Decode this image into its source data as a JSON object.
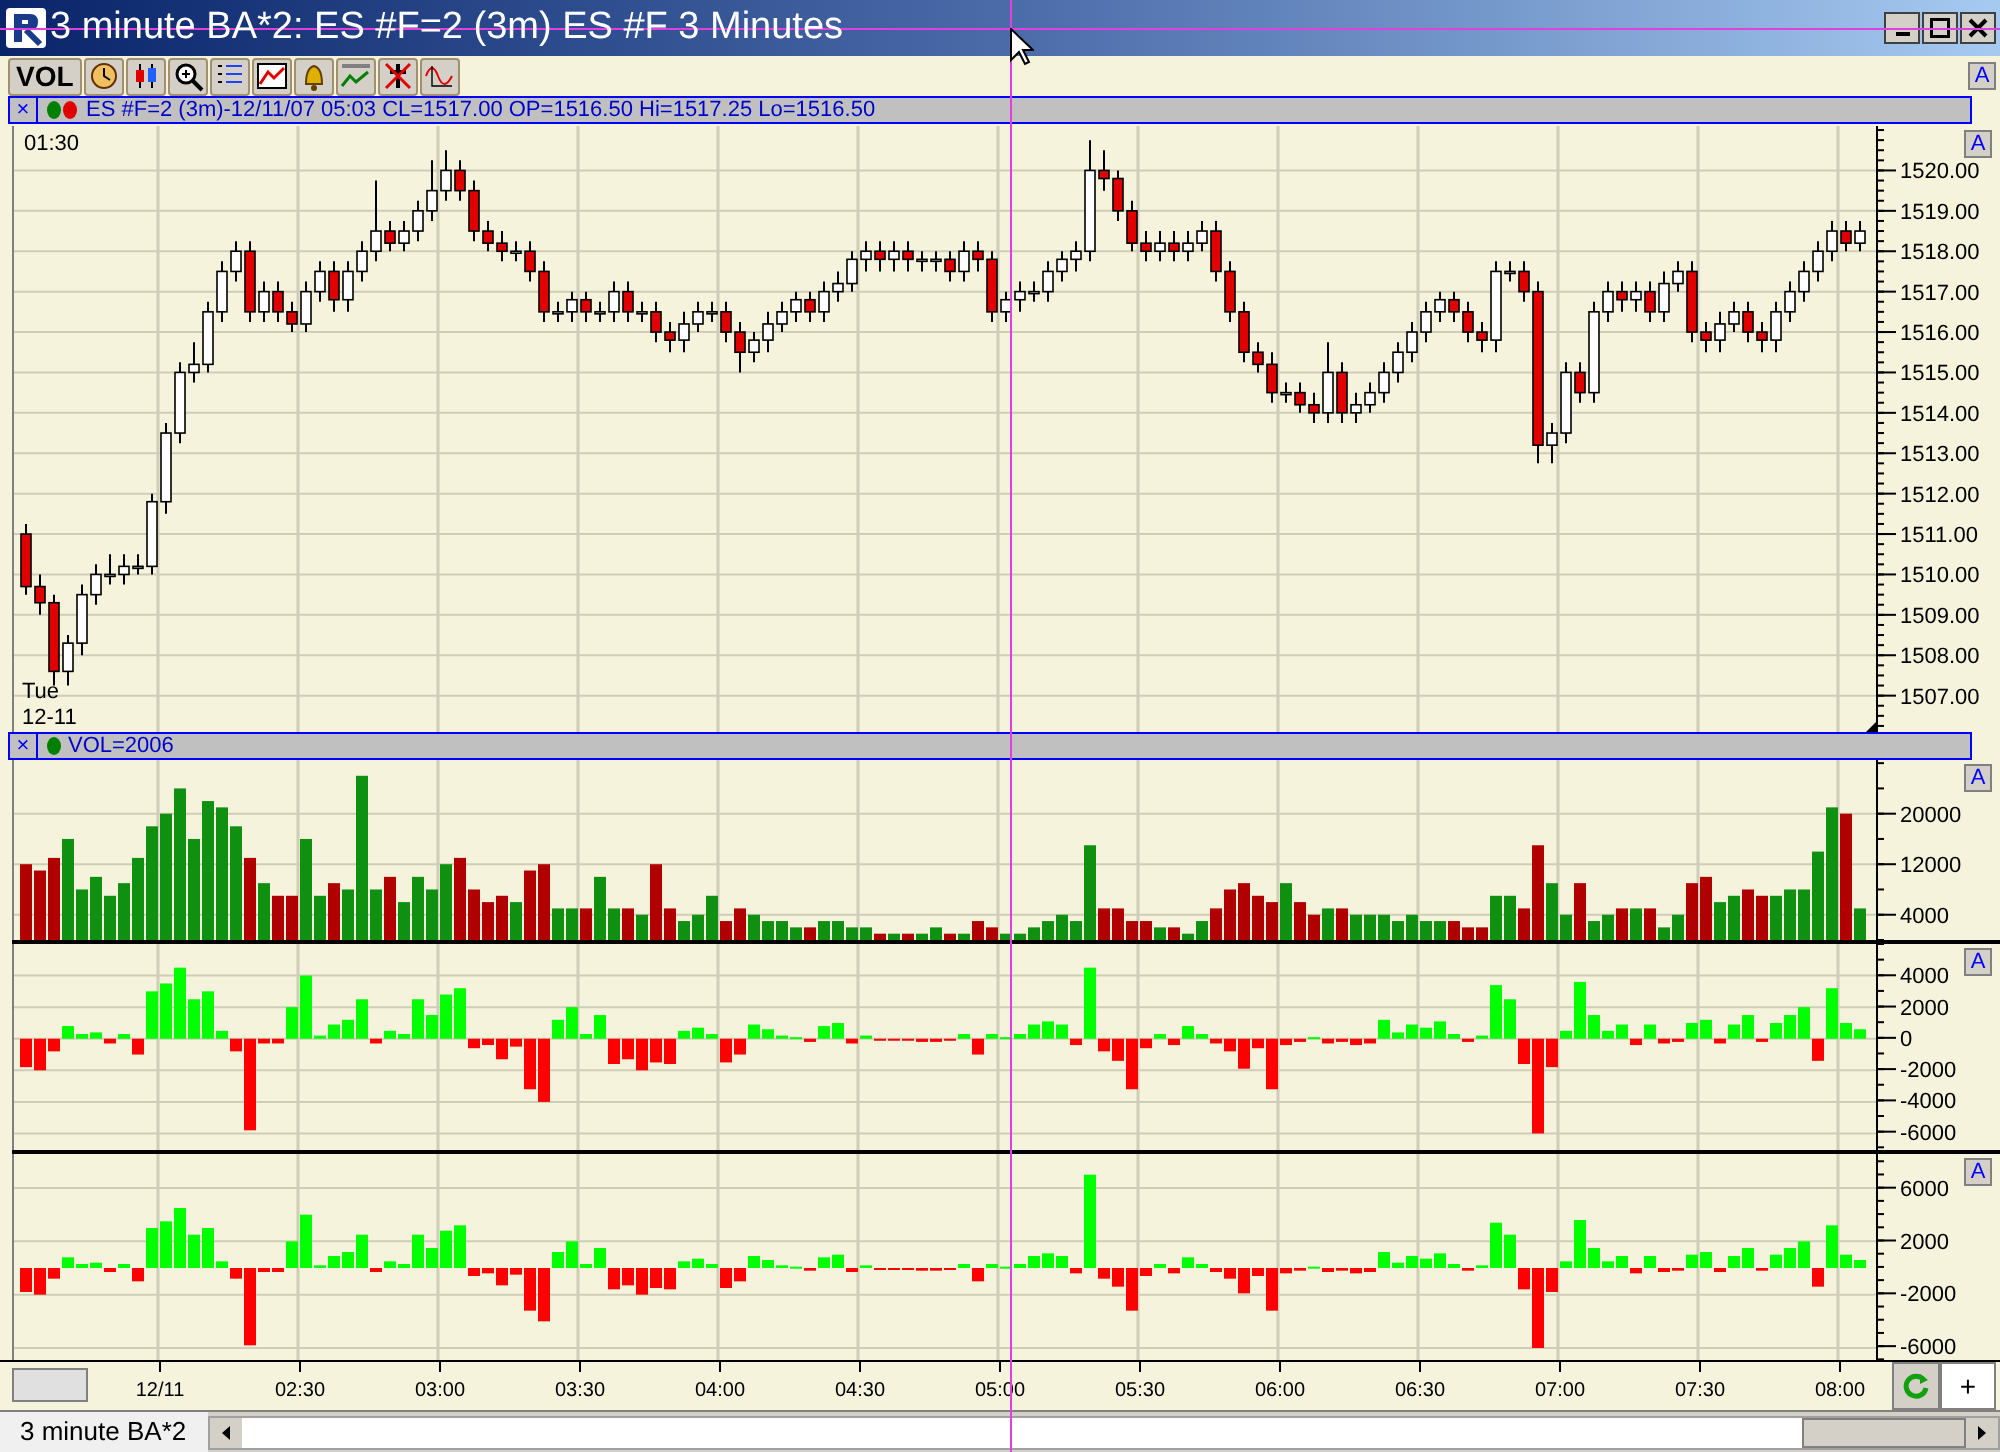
{
  "window": {
    "title": "3 minute BA*2: ES #F=2 (3m) ES #F 3 Minutes"
  },
  "toolbar": {
    "label": "VOL",
    "autoscale_label": "A"
  },
  "price_pane": {
    "close_label": "×",
    "legend": "ES #F=2 (3m)-12/11/07 05:03 CL=1517.00 OP=1516.50 Hi=1517.25 Lo=1516.50",
    "time_label": "01:30",
    "day_label": "Tue",
    "date_label": "12-11",
    "autoscale_label": "A",
    "chart_data": {
      "type": "candlestick",
      "grid": true,
      "ylim": [
        1506.1,
        1521.1
      ],
      "yticks": [
        {
          "value": 1507,
          "label": "1507.00"
        },
        {
          "value": 1508,
          "label": "1508.00"
        },
        {
          "value": 1509,
          "label": "1509.00"
        },
        {
          "value": 1510,
          "label": "1510.00"
        },
        {
          "value": 1511,
          "label": "1511.00"
        },
        {
          "value": 1512,
          "label": "1512.00"
        },
        {
          "value": 1513,
          "label": "1513.00"
        },
        {
          "value": 1514,
          "label": "1514.00"
        },
        {
          "value": 1515,
          "label": "1515.00"
        },
        {
          "value": 1516,
          "label": "1516.00"
        },
        {
          "value": 1517,
          "label": "1517.00"
        },
        {
          "value": 1518,
          "label": "1518.00"
        },
        {
          "value": 1519,
          "label": "1519.00"
        },
        {
          "value": 1520,
          "label": "1520.00"
        }
      ],
      "ohlc": [
        [
          1511,
          1511.25,
          1509.5,
          1509.7
        ],
        [
          1509.7,
          1510,
          1509,
          1509.3
        ],
        [
          1509.3,
          1509.5,
          1507.25,
          1507.6
        ],
        [
          1507.6,
          1508.5,
          1507.25,
          1508.3
        ],
        [
          1508.3,
          1509.75,
          1508,
          1509.5
        ],
        [
          1509.5,
          1510.25,
          1509.25,
          1510
        ],
        [
          1510,
          1510.5,
          1509.75,
          1510
        ],
        [
          1510,
          1510.5,
          1509.75,
          1510.2
        ],
        [
          1510.2,
          1510.5,
          1510,
          1510.2
        ],
        [
          1510.2,
          1512,
          1510,
          1511.8
        ],
        [
          1511.8,
          1513.75,
          1511.5,
          1513.5
        ],
        [
          1513.5,
          1515.25,
          1513.25,
          1515
        ],
        [
          1515,
          1515.75,
          1514.75,
          1515.2
        ],
        [
          1515.2,
          1516.75,
          1515,
          1516.5
        ],
        [
          1516.5,
          1517.75,
          1516.25,
          1517.5
        ],
        [
          1517.5,
          1518.25,
          1517.25,
          1518
        ],
        [
          1518,
          1518.25,
          1516.25,
          1516.5
        ],
        [
          1516.5,
          1517.25,
          1516.25,
          1517
        ],
        [
          1517,
          1517.25,
          1516.25,
          1516.5
        ],
        [
          1516.5,
          1516.75,
          1516,
          1516.2
        ],
        [
          1516.2,
          1517.25,
          1516,
          1517
        ],
        [
          1517,
          1517.75,
          1516.75,
          1517.5
        ],
        [
          1517.5,
          1517.75,
          1516.5,
          1516.8
        ],
        [
          1516.8,
          1517.75,
          1516.5,
          1517.5
        ],
        [
          1517.5,
          1518.25,
          1517.25,
          1518
        ],
        [
          1518,
          1519.75,
          1517.75,
          1518.5
        ],
        [
          1518.5,
          1518.75,
          1518,
          1518.2
        ],
        [
          1518.2,
          1518.75,
          1518,
          1518.5
        ],
        [
          1518.5,
          1519.25,
          1518.25,
          1519
        ],
        [
          1519,
          1520.25,
          1518.75,
          1519.5
        ],
        [
          1519.5,
          1520.5,
          1519.25,
          1520
        ],
        [
          1520,
          1520.25,
          1519.25,
          1519.5
        ],
        [
          1519.5,
          1519.75,
          1518.25,
          1518.5
        ],
        [
          1518.5,
          1518.75,
          1518,
          1518.2
        ],
        [
          1518.2,
          1518.5,
          1517.75,
          1518
        ],
        [
          1518,
          1518.25,
          1517.75,
          1518
        ],
        [
          1518,
          1518.25,
          1517.25,
          1517.5
        ],
        [
          1517.5,
          1517.75,
          1516.25,
          1516.5
        ],
        [
          1516.5,
          1516.75,
          1516.25,
          1516.5
        ],
        [
          1516.5,
          1517,
          1516.25,
          1516.8
        ],
        [
          1516.8,
          1517,
          1516.25,
          1516.5
        ],
        [
          1516.5,
          1516.75,
          1516.25,
          1516.5
        ],
        [
          1516.5,
          1517.25,
          1516.25,
          1517
        ],
        [
          1517,
          1517.25,
          1516.25,
          1516.5
        ],
        [
          1516.5,
          1516.75,
          1516.25,
          1516.5
        ],
        [
          1516.5,
          1516.75,
          1515.75,
          1516
        ],
        [
          1516,
          1516.25,
          1515.5,
          1515.8
        ],
        [
          1515.8,
          1516.5,
          1515.5,
          1516.2
        ],
        [
          1516.2,
          1516.75,
          1516,
          1516.5
        ],
        [
          1516.5,
          1516.75,
          1516.25,
          1516.5
        ],
        [
          1516.5,
          1516.75,
          1515.75,
          1516
        ],
        [
          1516,
          1516.25,
          1515,
          1515.5
        ],
        [
          1515.5,
          1516,
          1515.25,
          1515.8
        ],
        [
          1515.8,
          1516.5,
          1515.5,
          1516.2
        ],
        [
          1516.2,
          1516.75,
          1516,
          1516.5
        ],
        [
          1516.5,
          1517,
          1516.25,
          1516.8
        ],
        [
          1516.8,
          1517,
          1516.25,
          1516.5
        ],
        [
          1516.5,
          1517.25,
          1516.25,
          1517
        ],
        [
          1517,
          1517.5,
          1516.75,
          1517.2
        ],
        [
          1517.2,
          1518,
          1517,
          1517.8
        ],
        [
          1517.8,
          1518.25,
          1517.5,
          1518
        ],
        [
          1518,
          1518.25,
          1517.5,
          1517.8
        ],
        [
          1517.8,
          1518.25,
          1517.5,
          1518
        ],
        [
          1518,
          1518.25,
          1517.5,
          1517.8
        ],
        [
          1517.8,
          1518,
          1517.5,
          1517.8
        ],
        [
          1517.8,
          1518,
          1517.5,
          1517.8
        ],
        [
          1517.8,
          1518,
          1517.25,
          1517.5
        ],
        [
          1517.5,
          1518.25,
          1517.25,
          1518
        ],
        [
          1518,
          1518.25,
          1517.5,
          1517.8
        ],
        [
          1517.8,
          1518,
          1516.25,
          1516.5
        ],
        [
          1516.5,
          1517,
          1516.25,
          1516.8
        ],
        [
          1516.8,
          1517.25,
          1516.5,
          1517
        ],
        [
          1517,
          1517.25,
          1516.75,
          1517
        ],
        [
          1517,
          1517.75,
          1516.75,
          1517.5
        ],
        [
          1517.5,
          1518,
          1517.25,
          1517.8
        ],
        [
          1517.8,
          1518.25,
          1517.5,
          1518
        ],
        [
          1518,
          1520.75,
          1517.75,
          1520
        ],
        [
          1520,
          1520.5,
          1519.5,
          1519.8
        ],
        [
          1519.8,
          1520,
          1518.75,
          1519
        ],
        [
          1519,
          1519.25,
          1518,
          1518.2
        ],
        [
          1518.2,
          1518.5,
          1517.75,
          1518
        ],
        [
          1518,
          1518.5,
          1517.75,
          1518.2
        ],
        [
          1518.2,
          1518.5,
          1517.75,
          1518
        ],
        [
          1518,
          1518.5,
          1517.75,
          1518.2
        ],
        [
          1518.2,
          1518.75,
          1518,
          1518.5
        ],
        [
          1518.5,
          1518.75,
          1517.25,
          1517.5
        ],
        [
          1517.5,
          1517.75,
          1516.25,
          1516.5
        ],
        [
          1516.5,
          1516.75,
          1515.25,
          1515.5
        ],
        [
          1515.5,
          1515.75,
          1515,
          1515.2
        ],
        [
          1515.2,
          1515.5,
          1514.25,
          1514.5
        ],
        [
          1514.5,
          1514.75,
          1514.25,
          1514.5
        ],
        [
          1514.5,
          1514.75,
          1514,
          1514.2
        ],
        [
          1514.2,
          1514.5,
          1513.75,
          1514
        ],
        [
          1514,
          1515.75,
          1513.75,
          1515
        ],
        [
          1515,
          1515.25,
          1513.75,
          1514
        ],
        [
          1514,
          1514.5,
          1513.75,
          1514.2
        ],
        [
          1514.2,
          1514.75,
          1514,
          1514.5
        ],
        [
          1514.5,
          1515.25,
          1514.25,
          1515
        ],
        [
          1515,
          1515.75,
          1514.75,
          1515.5
        ],
        [
          1515.5,
          1516.25,
          1515.25,
          1516
        ],
        [
          1516,
          1516.75,
          1515.75,
          1516.5
        ],
        [
          1516.5,
          1517,
          1516.25,
          1516.8
        ],
        [
          1516.8,
          1517,
          1516.25,
          1516.5
        ],
        [
          1516.5,
          1516.75,
          1515.75,
          1516
        ],
        [
          1516,
          1516.25,
          1515.5,
          1515.8
        ],
        [
          1515.8,
          1517.75,
          1515.5,
          1517.5
        ],
        [
          1517.5,
          1517.75,
          1517.25,
          1517.5
        ],
        [
          1517.5,
          1517.75,
          1516.75,
          1517
        ],
        [
          1517,
          1517.25,
          1512.75,
          1513.2
        ],
        [
          1513.2,
          1513.75,
          1512.75,
          1513.5
        ],
        [
          1513.5,
          1515.25,
          1513.25,
          1515
        ],
        [
          1515,
          1515.25,
          1514.25,
          1514.5
        ],
        [
          1514.5,
          1516.75,
          1514.25,
          1516.5
        ],
        [
          1516.5,
          1517.25,
          1516.25,
          1517
        ],
        [
          1517,
          1517.25,
          1516.5,
          1516.8
        ],
        [
          1516.8,
          1517.25,
          1516.5,
          1517
        ],
        [
          1517,
          1517.25,
          1516.25,
          1516.5
        ],
        [
          1516.5,
          1517.5,
          1516.25,
          1517.2
        ],
        [
          1517.2,
          1517.75,
          1517,
          1517.5
        ],
        [
          1517.5,
          1517.75,
          1515.75,
          1516
        ],
        [
          1516,
          1516.25,
          1515.5,
          1515.8
        ],
        [
          1515.8,
          1516.5,
          1515.5,
          1516.2
        ],
        [
          1516.2,
          1516.75,
          1516,
          1516.5
        ],
        [
          1516.5,
          1516.75,
          1515.75,
          1516
        ],
        [
          1516,
          1516.25,
          1515.5,
          1515.8
        ],
        [
          1515.8,
          1516.75,
          1515.5,
          1516.5
        ],
        [
          1516.5,
          1517.25,
          1516.25,
          1517
        ],
        [
          1517,
          1517.75,
          1516.75,
          1517.5
        ],
        [
          1517.5,
          1518.25,
          1517.25,
          1518
        ],
        [
          1518,
          1518.75,
          1517.75,
          1518.5
        ],
        [
          1518.5,
          1518.75,
          1518,
          1518.2
        ],
        [
          1518.2,
          1518.75,
          1518,
          1518.5
        ]
      ]
    }
  },
  "volume_pane": {
    "close_label": "×",
    "legend": "VOL=2006",
    "autoscale_label": "A",
    "chart_data": {
      "type": "bar",
      "grid": true,
      "ylim": [
        0,
        28500
      ],
      "yticks": [
        4000,
        12000,
        20000
      ],
      "values": [
        12000,
        11000,
        13000,
        16000,
        8000,
        10000,
        7000,
        9000,
        13000,
        18000,
        20000,
        24000,
        16000,
        22000,
        21000,
        18000,
        13000,
        9000,
        7000,
        7000,
        16000,
        7000,
        9000,
        8000,
        26000,
        8000,
        10000,
        6000,
        10000,
        8000,
        12000,
        13000,
        8000,
        6000,
        7000,
        6000,
        11000,
        12000,
        5000,
        5000,
        5000,
        10000,
        5000,
        5000,
        4000,
        12000,
        5000,
        3000,
        4000,
        7000,
        3000,
        5000,
        4000,
        3000,
        3000,
        2000,
        2000,
        3000,
        3000,
        2000,
        2000,
        1000,
        1000,
        1000,
        1000,
        2000,
        1000,
        1000,
        3000,
        2000,
        1000,
        1000,
        2000,
        3000,
        4000,
        3000,
        15000,
        5000,
        5000,
        3000,
        3000,
        2000,
        2000,
        1000,
        3000,
        5000,
        8000,
        9000,
        7000,
        6000,
        9000,
        6000,
        4000,
        5000,
        5000,
        4000,
        4000,
        4000,
        3000,
        4000,
        3000,
        3000,
        3000,
        2000,
        2000,
        7000,
        7000,
        5000,
        15000,
        9000,
        4000,
        9000,
        3000,
        4000,
        5000,
        5000,
        5000,
        2000,
        4000,
        9000,
        10000,
        6000,
        7000,
        8000,
        7000,
        7000,
        8000,
        8000,
        14000,
        21000,
        20000,
        5000
      ]
    }
  },
  "delta_pane": {
    "autoscale_label": "A",
    "chart_data": {
      "type": "bar",
      "grid": true,
      "ylim": [
        -7300,
        6000
      ],
      "yticks": [
        4000,
        2000,
        0,
        -2000,
        -4000,
        -6000
      ],
      "values": [
        -1800,
        -2000,
        -800,
        800,
        300,
        400,
        -300,
        300,
        -1000,
        3000,
        3500,
        4500,
        2500,
        3000,
        500,
        -800,
        -5800,
        -300,
        -300,
        2000,
        4000,
        200,
        900,
        1200,
        2500,
        -300,
        500,
        300,
        2500,
        1500,
        2800,
        3200,
        -600,
        -400,
        -1300,
        -500,
        -3200,
        -4000,
        1200,
        2000,
        300,
        1500,
        -1600,
        -1300,
        -2000,
        -1500,
        -1600,
        500,
        700,
        300,
        -1500,
        -1000,
        900,
        600,
        200,
        100,
        -200,
        800,
        1000,
        -300,
        200,
        -100,
        -100,
        -100,
        -200,
        -200,
        -100,
        300,
        -1000,
        300,
        100,
        300,
        900,
        1100,
        900,
        -400,
        4500,
        -800,
        -1400,
        -3200,
        -600,
        300,
        -400,
        800,
        300,
        -300,
        -800,
        -1900,
        -600,
        -3200,
        -400,
        -200,
        100,
        -300,
        -200,
        -400,
        -300,
        1200,
        400,
        900,
        700,
        1100,
        300,
        -200,
        200,
        3400,
        2500,
        -1600,
        -6000,
        -1800,
        500,
        3600,
        1500,
        500,
        900,
        -400,
        900,
        -300,
        -200,
        1000,
        1200,
        -300,
        900,
        1500,
        -200,
        1000,
        1500,
        2000,
        -1400,
        3200,
        1000,
        600
      ]
    }
  },
  "delta_pane_2": {
    "autoscale_label": "A",
    "chart_data": {
      "type": "bar",
      "grid": true,
      "ylim": [
        -7200,
        8550
      ],
      "yticks": [
        6000,
        2000,
        -2000,
        -6000
      ],
      "values": [
        -1800,
        -2000,
        -800,
        800,
        300,
        400,
        -300,
        300,
        -1000,
        3000,
        3500,
        4500,
        2500,
        3000,
        500,
        -800,
        -5800,
        -300,
        -300,
        2000,
        4000,
        200,
        900,
        1200,
        2500,
        -300,
        500,
        300,
        2500,
        1500,
        2800,
        3200,
        -600,
        -400,
        -1300,
        -500,
        -3200,
        -4000,
        1200,
        2000,
        300,
        1500,
        -1600,
        -1300,
        -2000,
        -1500,
        -1600,
        500,
        700,
        300,
        -1500,
        -1000,
        900,
        600,
        200,
        100,
        -200,
        800,
        1000,
        -300,
        200,
        -100,
        -100,
        -100,
        -200,
        -200,
        -100,
        300,
        -1000,
        300,
        100,
        300,
        900,
        1100,
        900,
        -400,
        7000,
        -800,
        -1400,
        -3200,
        -600,
        300,
        -400,
        800,
        300,
        -300,
        -800,
        -1900,
        -600,
        -3200,
        -400,
        -200,
        100,
        -300,
        -200,
        -400,
        -300,
        1200,
        400,
        900,
        700,
        1100,
        300,
        -200,
        200,
        3400,
        2500,
        -1600,
        -6000,
        -1800,
        500,
        3600,
        1500,
        500,
        900,
        -400,
        900,
        -300,
        -200,
        1000,
        1200,
        -300,
        900,
        1500,
        -200,
        1000,
        1500,
        2000,
        -1400,
        3200,
        1000,
        600
      ]
    }
  },
  "time_axis": {
    "labels": [
      "12/11",
      "02:30",
      "03:00",
      "03:30",
      "04:00",
      "04:30",
      "05:00",
      "05:30",
      "06:00",
      "06:30",
      "07:00",
      "07:30",
      "08:00"
    ],
    "add_label": "+"
  },
  "sheet_tab": {
    "label": "3 minute BA*2"
  }
}
